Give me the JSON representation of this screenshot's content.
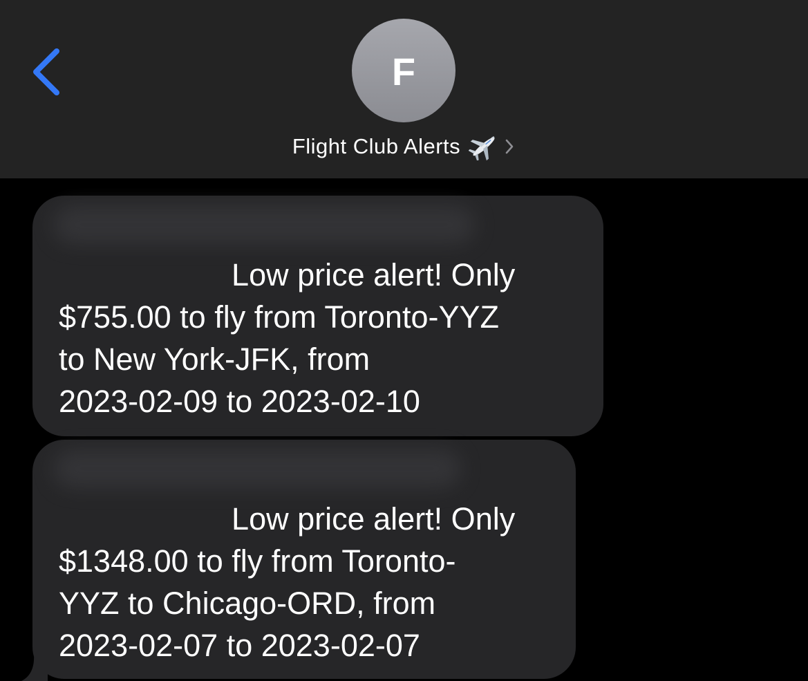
{
  "header": {
    "avatar_letter": "F",
    "contact_name": "Flight Club Alerts",
    "contact_emoji_icon": "airplane-icon",
    "colors": {
      "header_bg": "#232323",
      "back_accent": "#3478f6",
      "avatar_bg": "#9a9ba1"
    }
  },
  "messages": [
    {
      "text_lines": [
        "                    Low price alert! Only",
        "$755.00 to fly from Toronto-YYZ",
        "to New York-JFK, from",
        "2023-02-09 to 2023-02-10"
      ]
    },
    {
      "text_lines": [
        "                    Low price alert! Only",
        "$1348.00 to fly from Toronto-",
        "YYZ to Chicago-ORD, from",
        "2023-02-07 to 2023-02-07"
      ]
    }
  ],
  "colors": {
    "background": "#000000",
    "bubble_bg": "#262628",
    "text": "#ffffff"
  }
}
